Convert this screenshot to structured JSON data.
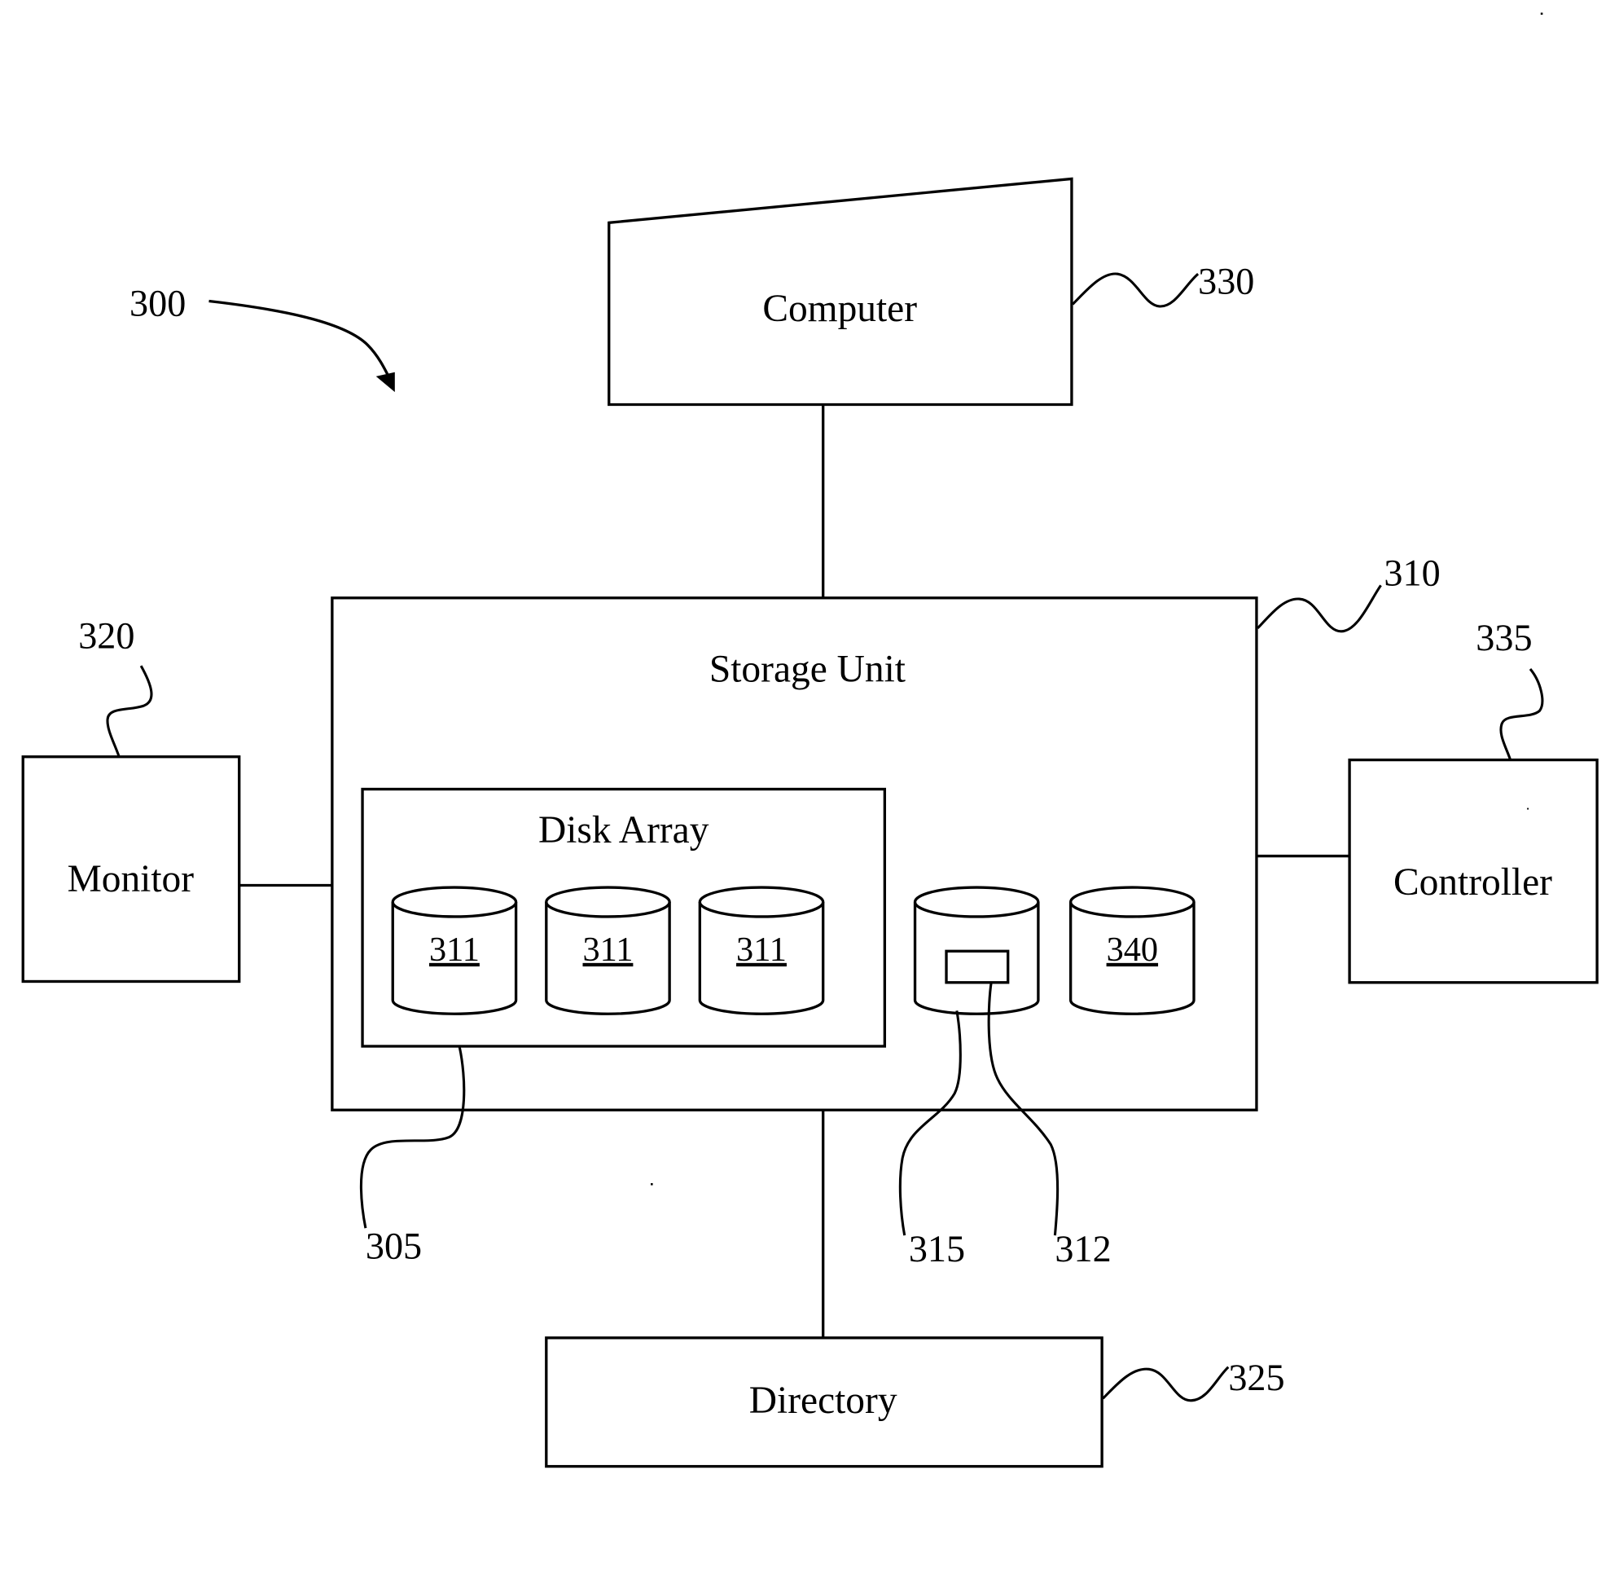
{
  "figure": {
    "reference": "300",
    "components": {
      "computer": {
        "label": "Computer",
        "ref": "330"
      },
      "storage_unit": {
        "label": "Storage Unit",
        "ref": "310"
      },
      "disk_array": {
        "label": "Disk Array",
        "ref": "305"
      },
      "disks": [
        {
          "label": "311"
        },
        {
          "label": "311"
        },
        {
          "label": "311"
        }
      ],
      "tagged_disk": {
        "ref": "315",
        "tag_ref": "312"
      },
      "disk_340": {
        "label": "340"
      },
      "monitor": {
        "label": "Monitor",
        "ref": "320"
      },
      "controller": {
        "label": "Controller",
        "ref": "335"
      },
      "directory": {
        "label": "Directory",
        "ref": "325"
      }
    }
  }
}
